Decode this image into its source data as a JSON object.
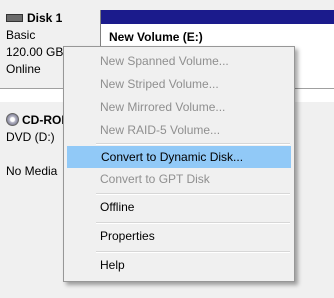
{
  "disks": {
    "disk1": {
      "name": "Disk 1",
      "type": "Basic",
      "size": "120.00 GB",
      "status": "Online",
      "volume_label": "New Volume  (E:)",
      "volume_color": "#1b1b8c"
    },
    "cdrom": {
      "name": "CD-ROM",
      "drive": "DVD (D:)",
      "status": "No Media"
    }
  },
  "context_menu": {
    "items": [
      {
        "label": "New Spanned Volume...",
        "enabled": false
      },
      {
        "label": "New Striped Volume...",
        "enabled": false
      },
      {
        "label": "New Mirrored Volume...",
        "enabled": false
      },
      {
        "label": "New RAID-5 Volume...",
        "enabled": false
      },
      {
        "label": "Convert to Dynamic Disk...",
        "enabled": true,
        "highlighted": true
      },
      {
        "label": "Convert to GPT Disk",
        "enabled": false
      },
      {
        "label": "Offline",
        "enabled": true
      },
      {
        "label": "Properties",
        "enabled": true
      },
      {
        "label": "Help",
        "enabled": true
      }
    ],
    "highlight_color": "#91c9f7"
  }
}
